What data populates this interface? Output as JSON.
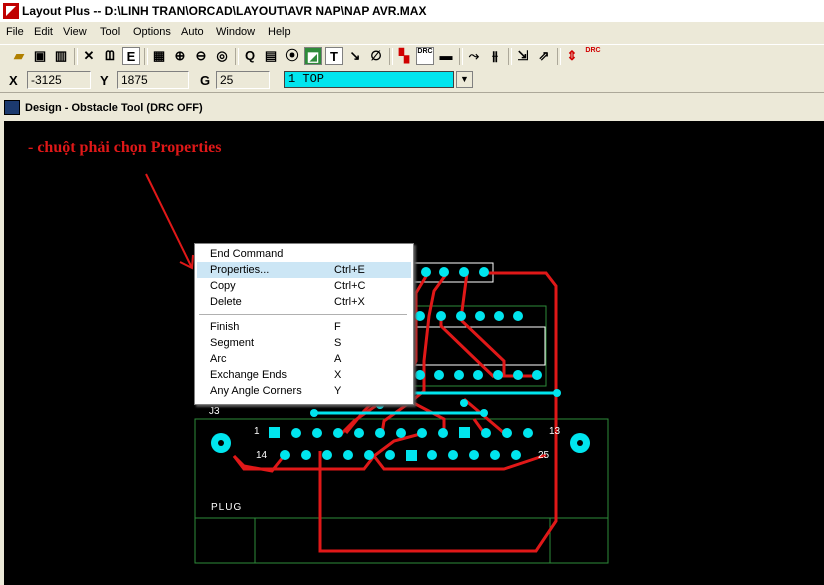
{
  "window": {
    "title": "Layout Plus -- D:\\LINH TRAN\\ORCAD\\LAYOUT\\AVR NAP\\NAP AVR.MAX"
  },
  "menu": [
    "File",
    "Edit",
    "View",
    "Tool",
    "Options",
    "Auto",
    "Window",
    "Help"
  ],
  "coords": {
    "x_label": "X",
    "x_value": "-3125",
    "y_label": "Y",
    "y_value": "1875",
    "g_label": "G",
    "g_value": "25"
  },
  "layer": {
    "selected": "1  TOP"
  },
  "document": {
    "title": "Design - Obstacle Tool (DRC OFF)"
  },
  "annotation": {
    "text": "- chuột phải chọn Properties"
  },
  "context_menu": {
    "items": [
      {
        "label": "End Command",
        "shortcut": ""
      },
      {
        "label": "Properties...",
        "shortcut": "Ctrl+E"
      },
      {
        "label": "Copy",
        "shortcut": "Ctrl+C"
      },
      {
        "label": "Delete",
        "shortcut": "Ctrl+X"
      },
      {
        "label": "Finish",
        "shortcut": "F"
      },
      {
        "label": "Segment",
        "shortcut": "S"
      },
      {
        "label": "Arc",
        "shortcut": "A"
      },
      {
        "label": "Exchange Ends",
        "shortcut": "X"
      },
      {
        "label": "Any Angle Corners",
        "shortcut": "Y"
      }
    ]
  },
  "pcb": {
    "ref": "J3",
    "pin1": "1",
    "pin13": "13",
    "pin14": "14",
    "pin25": "25",
    "plug": "PLUG"
  },
  "toolbar": {
    "e_glyph": "E",
    "q_glyph": "Q",
    "t_glyph": "T",
    "drc1": "DRC",
    "drc2": "DRC"
  },
  "colors": {
    "trace": "#e01818",
    "pad": "#00e5ee",
    "outline": "#ffffff",
    "board": "#2e8b3a",
    "highlight": "#cce6f5"
  }
}
